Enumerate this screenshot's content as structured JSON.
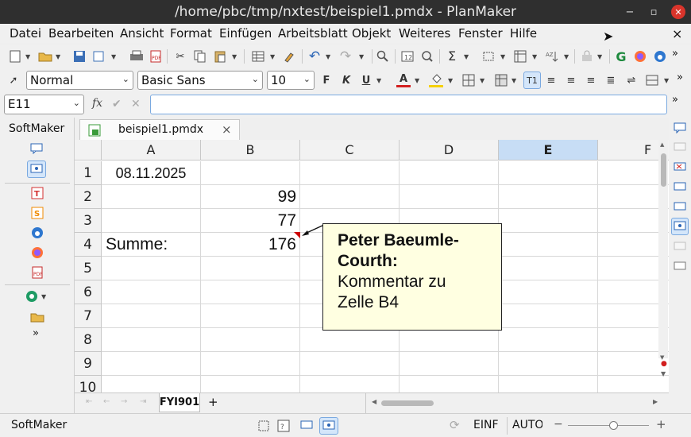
{
  "window": {
    "title": "/home/pbc/tmp/nxtest/beispiel1.pmdx - PlanMaker",
    "minimize_glyph": "−",
    "restore_glyph": "▫",
    "close_glyph": "✕"
  },
  "menu": [
    "Datei",
    "Bearbeiten",
    "Ansicht",
    "Format",
    "Einfügen",
    "Arbeitsblatt",
    "Objekt",
    "Weiteres",
    "Fenster",
    "Hilfe"
  ],
  "menu_close_glyph": "×",
  "format_bar": {
    "style": "Normal",
    "font": "Basic Sans",
    "size": "10",
    "bold": "F",
    "italic": "K",
    "underline": "U",
    "font_color": "A"
  },
  "formula_bar": {
    "cell_ref": "E11",
    "fx": "fx",
    "accept": "✔",
    "cancel": "✕",
    "content": ""
  },
  "sidebar": {
    "title": "SoftMaker",
    "more": "»"
  },
  "document_tab": {
    "name": "beispiel1.pmdx",
    "close_glyph": "×"
  },
  "columns": [
    "A",
    "B",
    "C",
    "D",
    "E",
    "F"
  ],
  "selected_column": "E",
  "rows": [
    "1",
    "2",
    "3",
    "4",
    "5",
    "6",
    "7",
    "8",
    "9",
    "10"
  ],
  "cells": {
    "A1": "08.11.2025",
    "B2": "99",
    "B3": "77",
    "A4": "Summe:",
    "B4": "176"
  },
  "comment": {
    "author": "Peter Baeumle-Courth:",
    "text": "Kommentar zu Zelle B4"
  },
  "sheet_tabs": [
    "FYI901"
  ],
  "add_sheet": "+",
  "status": {
    "left": "SoftMaker",
    "mode": "EINF",
    "calc": "AUTO",
    "zoom_minus": "−",
    "zoom_plus": "+"
  },
  "colors": {
    "accent": "#1a73e8",
    "selected_col": "#c7ddf5",
    "comment_bg": "#ffffe1",
    "note_marker": "#cc0000"
  }
}
